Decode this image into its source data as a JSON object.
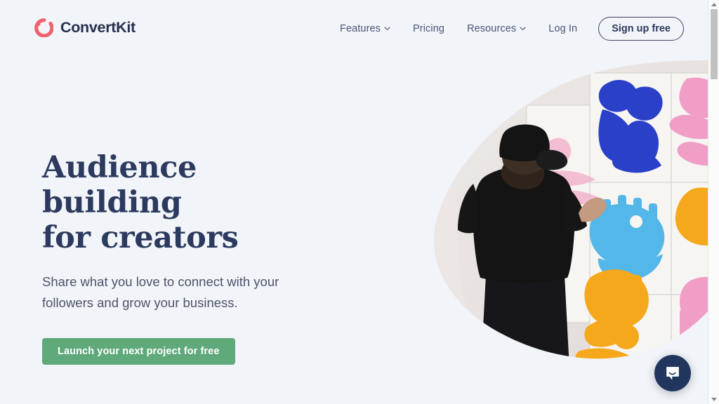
{
  "brand": {
    "name": "ConvertKit",
    "logo_icon": "convertkit-ring-logo",
    "logo_color": "#f0616e",
    "text_color": "#27304f"
  },
  "nav": {
    "items": [
      {
        "label": "Features",
        "icon": "chevron-down-icon",
        "has_caret": true
      },
      {
        "label": "Pricing",
        "icon": "",
        "has_caret": false
      },
      {
        "label": "Resources",
        "icon": "chevron-down-icon",
        "has_caret": true
      },
      {
        "label": "Log In",
        "icon": "",
        "has_caret": false
      }
    ],
    "signup_label": "Sign up free"
  },
  "hero": {
    "headline_line1": "Audience building",
    "headline_line2": "for creators",
    "subheadline": "Share what you love to connect with your followers and grow your business.",
    "cta_label": "Launch your next project for free",
    "cta_color": "#5fa97b",
    "headline_color": "#2b3a5e",
    "image_alt": "Artist in black t-shirt and cap painting colorful abstract glyphs on a grid of white wall panels"
  },
  "chat": {
    "icon": "chat-bubble-icon",
    "color": "#21365c"
  },
  "scrollbar": {
    "up_icon": "scroll-up-arrow-icon",
    "down_icon": "scroll-down-arrow-icon",
    "thumb_name": "scrollbar-thumb"
  },
  "page": {
    "background_color": "#f1f4f8"
  }
}
